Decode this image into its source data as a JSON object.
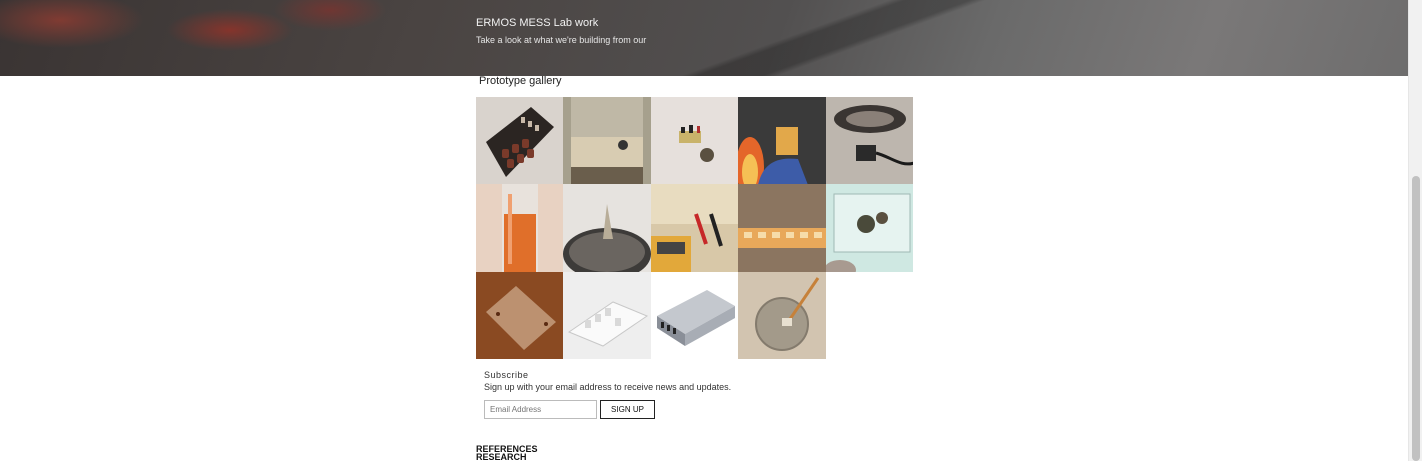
{
  "hero": {
    "title": "ERMOS MESS Lab work",
    "subtitle": "Take a look at what we're building from our"
  },
  "gallery": {
    "title": "Prototype gallery",
    "items": [
      {
        "name": "gallery-image-1",
        "bg": "#d9d3cd",
        "fg": "#7a3a2a"
      },
      {
        "name": "gallery-image-2",
        "bg": "#b7b09e",
        "fg": "#d9cdb5"
      },
      {
        "name": "gallery-image-3",
        "bg": "#e6e0dc",
        "fg": "#5a5040"
      },
      {
        "name": "gallery-image-4",
        "bg": "#3a3a3a",
        "fg": "#e2a84a"
      },
      {
        "name": "gallery-image-5",
        "bg": "#bdb6ae",
        "fg": "#2a2a2a"
      },
      {
        "name": "gallery-image-6",
        "bg": "#e8d2c2",
        "fg": "#e06f2a"
      },
      {
        "name": "gallery-image-7",
        "bg": "#e6e3df",
        "fg": "#3d3b39"
      },
      {
        "name": "gallery-image-8",
        "bg": "#d8c8a8",
        "fg": "#e2a83a"
      },
      {
        "name": "gallery-image-9",
        "bg": "#8b7560",
        "fg": "#e8a85a"
      },
      {
        "name": "gallery-image-10",
        "bg": "#cfe8e2",
        "fg": "#4a4a3a"
      },
      {
        "name": "gallery-image-11",
        "bg": "#8a4a22",
        "fg": "#c8a285"
      },
      {
        "name": "gallery-image-12",
        "bg": "#eeeeee",
        "fg": "#d9d9d9"
      },
      {
        "name": "gallery-image-13",
        "bg": "#ffffff",
        "fg": "#8a8f98"
      },
      {
        "name": "gallery-image-14",
        "bg": "#d2c4b0",
        "fg": "#a39a8a"
      }
    ]
  },
  "subscribe": {
    "title": "Subscribe",
    "description": "Sign up with your email address to receive news and updates.",
    "email_placeholder": "Email Address",
    "button_label": "SIGN UP"
  },
  "footer": {
    "references": "REFERENCES",
    "research": "RESEARCH"
  }
}
